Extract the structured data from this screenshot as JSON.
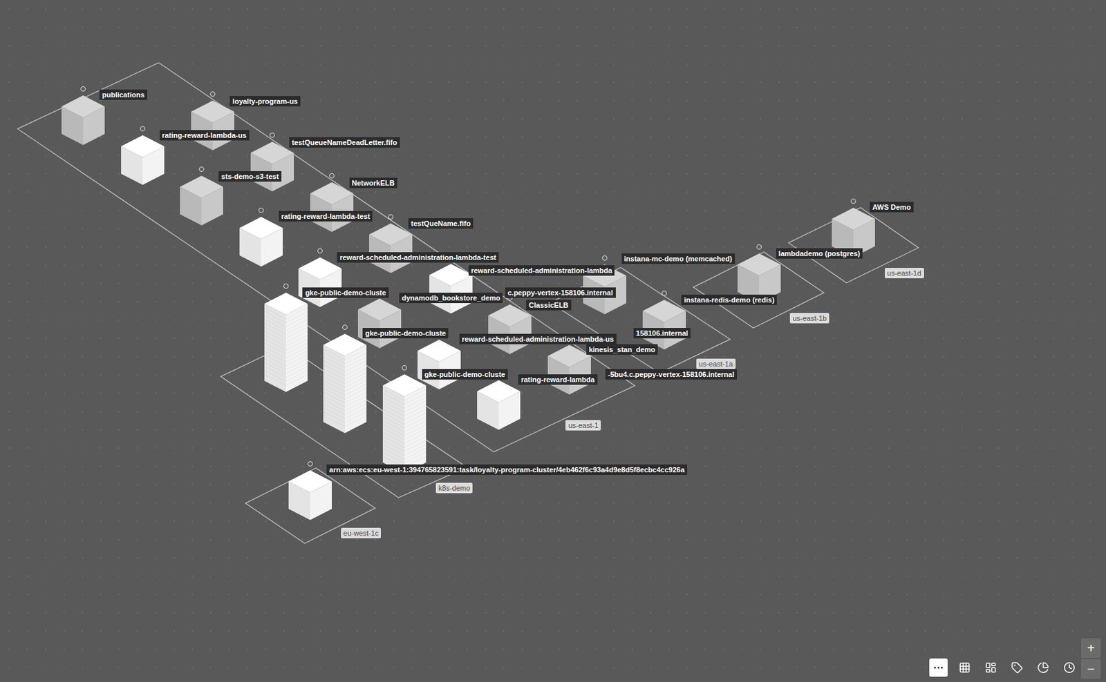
{
  "map": {
    "nodes": [
      {
        "label": "publications",
        "kind": "shaded"
      },
      {
        "label": "loyalty-program-us",
        "kind": "shaded"
      },
      {
        "label": "rating-reward-lambda-us",
        "kind": "light"
      },
      {
        "label": "testQueueNameDeadLetter.fifo",
        "kind": "shaded"
      },
      {
        "label": "sts-demo-s3-test",
        "kind": "shaded"
      },
      {
        "label": "NetworkELB",
        "kind": "shaded"
      },
      {
        "label": "rating-reward-lambda-test",
        "kind": "light"
      },
      {
        "label": "testQueName.fifo",
        "kind": "shaded"
      },
      {
        "label": "reward-scheduled-administration-lambda-test",
        "kind": "light"
      },
      {
        "label": "reward-scheduled-administration-lambda",
        "kind": "light"
      },
      {
        "label": "instana-mc-demo (memcached)",
        "kind": "shaded"
      },
      {
        "label": "lambdademo (postgres)",
        "kind": "shaded"
      },
      {
        "label": "AWS Demo",
        "kind": "shaded"
      },
      {
        "label": "gke-public-demo-cluste",
        "tail": "c.peppy-vertex-158106.internal",
        "kind": "stack"
      },
      {
        "label": "dynamodb_bookstore_demo",
        "kind": "shaded"
      },
      {
        "label": "ClassicELB",
        "kind": "shaded"
      },
      {
        "label": "instana-redis-demo (redis)",
        "kind": "shaded"
      },
      {
        "label": "gke-public-demo-cluste",
        "tail": "158106.internal",
        "kind": "stack"
      },
      {
        "label": "reward-scheduled-administration-lambda-us",
        "kind": "light"
      },
      {
        "label": "kinesis_stan_demo",
        "kind": "shaded"
      },
      {
        "label": "gke-public-demo-cluste",
        "tail": "-5bu4.c.peppy-vertex-158106.internal",
        "kind": "stack"
      },
      {
        "label": "rating-reward-lambda",
        "kind": "light"
      },
      {
        "label": "arn:aws:ecs:eu-west-1:394765823591:task/loyalty-program-cluster/4eb462f6c93a4d9e8d5f8ecbc4cc926a",
        "kind": "light"
      }
    ],
    "zones": [
      {
        "label": "us-east-1d"
      },
      {
        "label": "us-east-1b"
      },
      {
        "label": "us-east-1a"
      },
      {
        "label": "us-east-1"
      },
      {
        "label": "k8s-demo"
      },
      {
        "label": "eu-west-1c"
      }
    ]
  },
  "toolbar": {
    "buttons": [
      {
        "kind": "more",
        "selected": true
      },
      {
        "kind": "grid",
        "selected": false
      },
      {
        "kind": "layout",
        "selected": false
      },
      {
        "kind": "tag",
        "selected": false
      },
      {
        "kind": "pie",
        "selected": false
      },
      {
        "kind": "clock",
        "selected": false
      }
    ]
  },
  "zoom": [
    "+",
    "−"
  ]
}
